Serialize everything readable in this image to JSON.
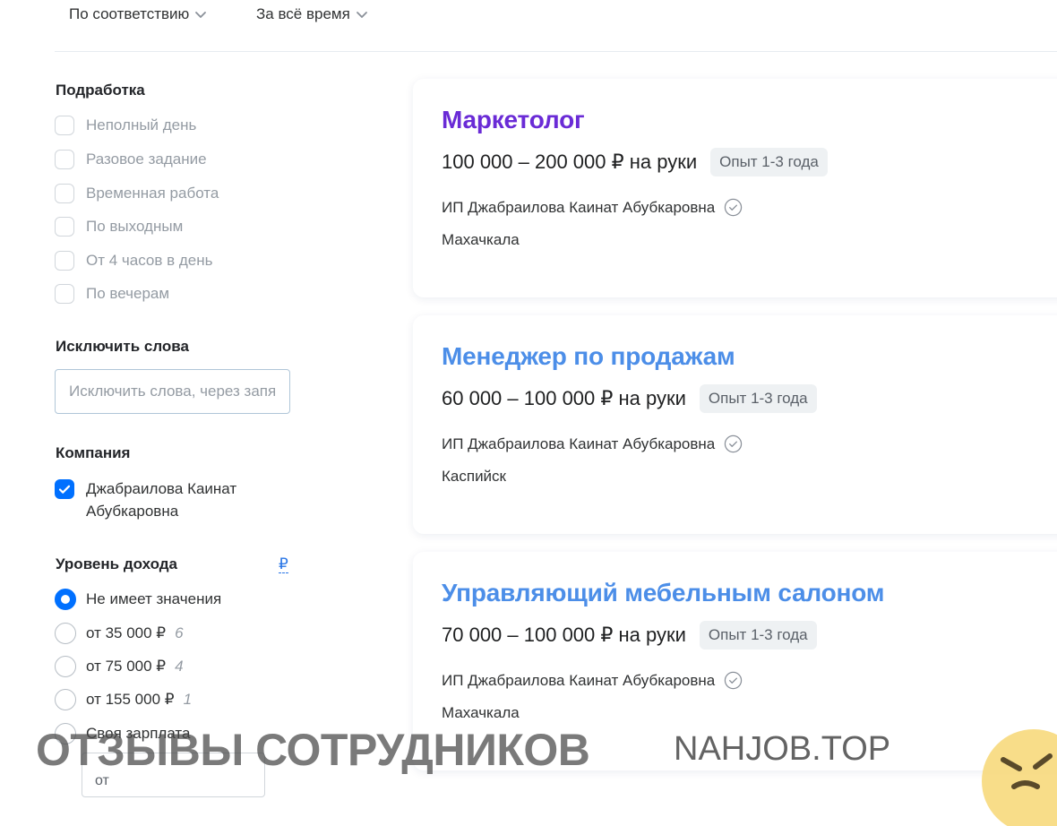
{
  "sort": {
    "relevance_label": "По соответствию",
    "period_label": "За всё время"
  },
  "filters": {
    "parttime": {
      "title": "Подработка",
      "options": [
        "Неполный день",
        "Разовое задание",
        "Временная работа",
        "По выходным",
        "От 4 часов в день",
        "По вечерам"
      ]
    },
    "exclude_words": {
      "title": "Исключить слова",
      "placeholder": "Исключить слова, через запятую"
    },
    "company": {
      "title": "Компания",
      "option_line1": "Джабраилова Каинат",
      "option_line2": "Абубкаровна",
      "checked": true
    },
    "income": {
      "title": "Уровень дохода",
      "currency_symbol": "₽",
      "options": [
        {
          "label": "Не имеет значения",
          "count": "",
          "selected": true
        },
        {
          "label": "от 35 000 ₽",
          "count": "6",
          "selected": false
        },
        {
          "label": "от 75 000 ₽",
          "count": "4",
          "selected": false
        },
        {
          "label": "от 155 000 ₽",
          "count": "1",
          "selected": false
        },
        {
          "label": "Своя зарплата",
          "count": "",
          "selected": false
        }
      ],
      "from_placeholder": "от"
    }
  },
  "vacancies": [
    {
      "title": "Маркетолог",
      "visited": true,
      "salary": "100 000 – 200 000 ₽ на руки",
      "experience": "Опыт 1-3 года",
      "company": "ИП Джабраилова Каинат Абубкаровна",
      "city": "Махачкала"
    },
    {
      "title": "Менеджер по продажам",
      "visited": false,
      "salary": "60 000 – 100 000 ₽ на руки",
      "experience": "Опыт 1-3 года",
      "company": "ИП Джабраилова Каинат Абубкаровна",
      "city": "Каспийск"
    },
    {
      "title": "Управляющий мебельным салоном",
      "visited": false,
      "salary": "70 000 – 100 000 ₽ на руки",
      "experience": "Опыт 1-3 года",
      "company": "ИП Джабраилова Каинат Абубкаровна",
      "city": "Махачкала"
    }
  ],
  "watermark": {
    "left_text": "ОТЗЫВЫ СОТРУДНИКОВ",
    "right_text": "NAHJOB.TOP",
    "icon": "angry-face-icon"
  },
  "colors": {
    "accent": "#0070ff",
    "visited_title": "#6a2bd6",
    "link_title": "#4c8ee8",
    "badge_bg": "#eef1f3"
  }
}
